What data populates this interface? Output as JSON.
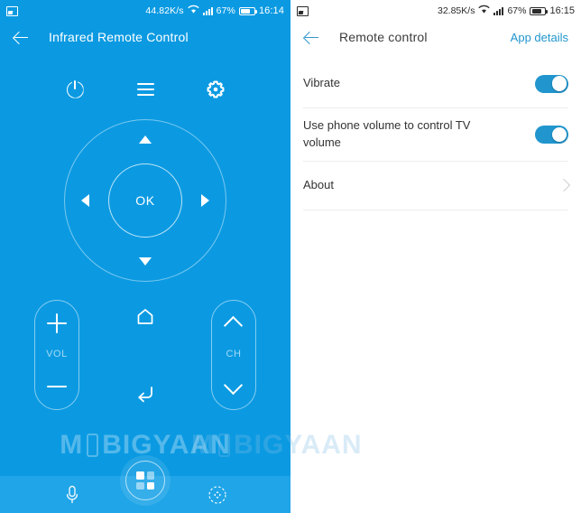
{
  "left": {
    "status_bar": {
      "notification_icon": "screenshot-icon",
      "network_speed": "44.82K/s",
      "wifi_icon": "wifi-icon",
      "signal_icon": "signal-bars-icon",
      "battery_percent": "67%",
      "battery_icon": "battery-icon",
      "time": "16:14"
    },
    "app_bar": {
      "back_icon": "back-arrow-icon",
      "title": "Infrared Remote Control"
    },
    "top_controls": [
      {
        "name": "power",
        "icon": "power-icon"
      },
      {
        "name": "menu",
        "icon": "menu-icon"
      },
      {
        "name": "settings",
        "icon": "gear-icon"
      }
    ],
    "dpad": {
      "up": "up-arrow-icon",
      "down": "down-arrow-icon",
      "left": "left-arrow-icon",
      "right": "right-arrow-icon",
      "center_label": "OK"
    },
    "volume": {
      "label": "VOL",
      "up_icon": "plus-icon",
      "down_icon": "minus-icon"
    },
    "channel": {
      "label": "CH",
      "up_icon": "chevron-up-icon",
      "down_icon": "chevron-down-icon"
    },
    "center_buttons": [
      {
        "name": "home",
        "icon": "home-icon"
      },
      {
        "name": "back",
        "icon": "back-return-icon"
      }
    ],
    "bottom_nav": [
      {
        "name": "voice",
        "icon": "microphone-icon"
      },
      {
        "name": "apps",
        "icon": "grid-squares-icon"
      },
      {
        "name": "touchpad",
        "icon": "touchpad-icon"
      }
    ],
    "watermark": {
      "prefix": "M",
      "suffix": "BIGYAAN"
    }
  },
  "right": {
    "status_bar": {
      "notification_icon": "screenshot-icon",
      "network_speed": "32.85K/s",
      "wifi_icon": "wifi-icon",
      "signal_icon": "signal-bars-icon",
      "battery_percent": "67%",
      "battery_icon": "battery-icon",
      "time": "16:15"
    },
    "app_bar": {
      "back_icon": "back-arrow-icon",
      "title": "Remote control",
      "action_label": "App details"
    },
    "settings": [
      {
        "label": "Vibrate",
        "control": "toggle",
        "value": "on"
      },
      {
        "label": "Use phone volume to control TV volume",
        "control": "toggle",
        "value": "on"
      },
      {
        "label": "About",
        "control": "chevron",
        "value": ""
      }
    ]
  },
  "colors": {
    "primary_blue": "#0B9AE2",
    "nav_blue": "#1FA5E8",
    "accent_blue": "#2196CE",
    "white": "#FFFFFF",
    "divider": "#EDEDED",
    "text_dark": "#333333"
  }
}
